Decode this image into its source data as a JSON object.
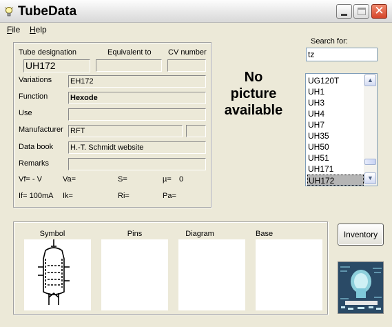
{
  "window": {
    "title": "TubeData"
  },
  "menu": {
    "file": "File",
    "help": "Help"
  },
  "fields": {
    "tube_designation": {
      "label": "Tube designation",
      "value": "UH172"
    },
    "equivalent_to": {
      "label": "Equivalent to",
      "value": ""
    },
    "cv_number": {
      "label": "CV number",
      "value": ""
    },
    "variations": {
      "label": "Variations",
      "value": "EH172"
    },
    "function": {
      "label": "Function",
      "value": "Hexode"
    },
    "use": {
      "label": "Use",
      "value": ""
    },
    "manufacturer": {
      "label": "Manufacturer",
      "value": "RFT",
      "extra": ""
    },
    "data_book": {
      "label": "Data book",
      "value": "H.-T. Schmidt website"
    },
    "remarks": {
      "label": "Remarks",
      "value": ""
    }
  },
  "params": {
    "vf": "Vf= - V",
    "va": "Va=",
    "s": "S=",
    "mu": "µ=",
    "mu_value": "0",
    "if": "If= 100mA",
    "ik": "Ik=",
    "ri": "Ri=",
    "pa": "Pa="
  },
  "picture": {
    "line1": "No",
    "line2": "picture",
    "line3": "available"
  },
  "search": {
    "label": "Search for:",
    "value": "tz"
  },
  "tube_list": {
    "items": [
      "UG120T",
      "UH1",
      "UH3",
      "UH4",
      "UH7",
      "UH35",
      "UH50",
      "UH51",
      "UH171",
      "UH172"
    ],
    "selected": "UH172"
  },
  "panels": {
    "symbol": "Symbol",
    "pins": "Pins",
    "diagram": "Diagram",
    "base": "Base"
  },
  "buttons": {
    "inventory": "Inventory"
  },
  "icons": [
    "lightbulb-icon",
    "minimize-icon",
    "maximize-icon",
    "close-icon",
    "scroll-up-icon",
    "scroll-down-icon",
    "tube-symbol-icon",
    "tube-logo-icon"
  ]
}
